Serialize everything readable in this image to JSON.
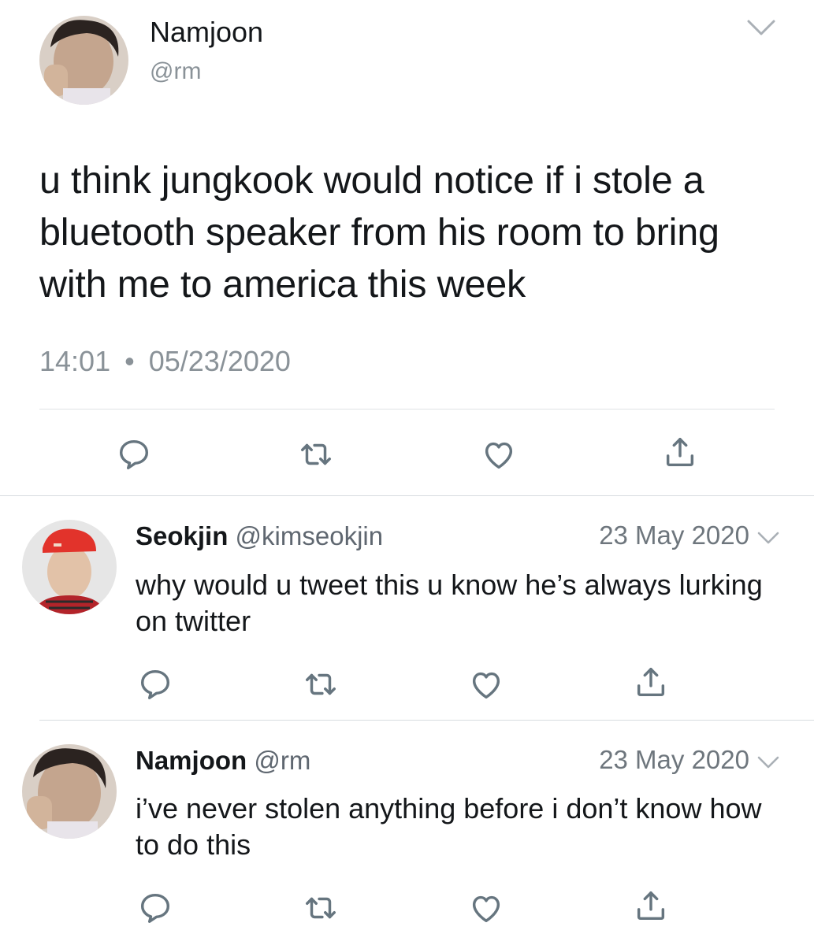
{
  "main_tweet": {
    "name": "Namjoon",
    "handle": "@rm",
    "text": "u think jungkook would notice if i stole a bluetooth speaker from his room to bring with me to america this week",
    "time": "14:01",
    "separator": "•",
    "date": "05/23/2020",
    "actions": [
      "reply-icon",
      "retweet-icon",
      "like-icon",
      "share-icon"
    ]
  },
  "replies": [
    {
      "name": "Seokjin",
      "handle": "@kimseokjin",
      "date": "23 May 2020",
      "text": "why would u tweet this u know he’s always lurking on twitter"
    },
    {
      "name": "Namjoon",
      "handle": "@rm",
      "date": "23 May 2020",
      "text": "i’ve never stolen anything before i don’t know how to do this"
    }
  ],
  "colors": {
    "text": "#14171a",
    "muted": "#8a9298",
    "icon": "#66757f",
    "divider": "#dfe2e5"
  }
}
